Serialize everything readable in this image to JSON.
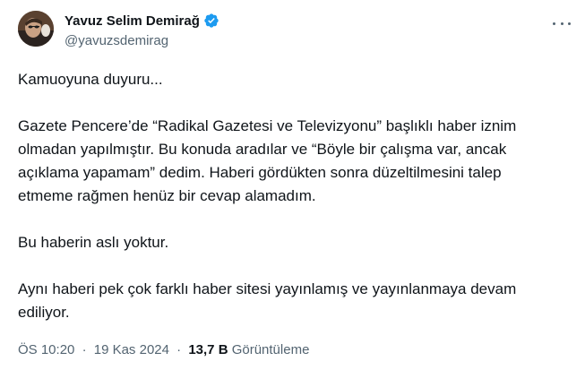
{
  "author": {
    "display_name": "Yavuz Selim Demirağ",
    "handle": "@yavuzsdemirag",
    "verified": true,
    "verified_color": "#1d9bf0"
  },
  "tweet": {
    "paragraphs": [
      [
        "Kamuoyuna duyuru..."
      ],
      [
        "Gazete Pencere’de “Radikal Gazetesi ve Televizyonu” başlıklı haber iznim",
        "olmadan yapılmıştır. Bu konuda aradılar ve “Böyle bir çalışma var, ancak",
        "açıklama yapamam” dedim. Haberi gördükten sonra düzeltilmesini talep",
        "etmeme rağmen henüz bir cevap alamadım."
      ],
      [
        "Bu haberin aslı yoktur."
      ],
      [
        "Aynı haberi pek çok farklı haber sitesi yayınlamış ve yayınlanmaya devam",
        "ediliyor."
      ]
    ]
  },
  "meta": {
    "time": "ÖS 10:20",
    "separator": "·",
    "date": "19 Kas 2024",
    "views_count": "13,7 B",
    "views_label": "Görüntüleme"
  },
  "icons": {
    "more": "more-horizontal-icon",
    "verified": "verified-badge-icon"
  }
}
